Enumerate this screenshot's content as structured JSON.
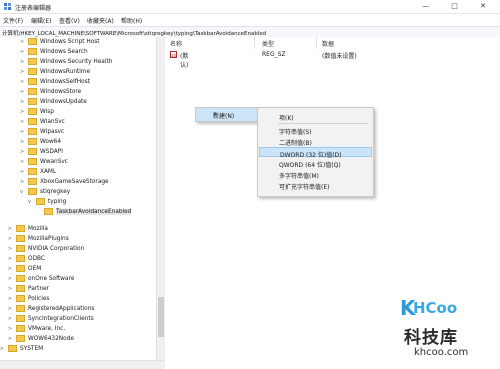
{
  "window": {
    "title": "注册表编辑器",
    "controls": "— □ ✕"
  },
  "menubar": {
    "items": [
      "文件(F)",
      "编辑(E)",
      "查看(V)",
      "收藏夹(A)",
      "帮助(H)"
    ]
  },
  "address": "计算机\\HKEY_LOCAL_MACHINE\\SOFTWARE\\Microsoft\\stiqregkey\\typing\\TaskbarAvoidanceEnabled",
  "tree": {
    "items": [
      "Windows Script Host",
      "Windows Search",
      "Windows Security Health",
      "WindowsRuntime",
      "WindowsSelfHost",
      "WindowsStore",
      "WindowsUpdate",
      "Wisp",
      "WlanSvc",
      "Wlpasvc",
      "Wow64",
      "WSDAPI",
      "WwanSvc",
      "XAML",
      "XboxGameSaveStorage",
      "stiqregkey",
      "typing",
      "TaskbarAvoidanceEnabled",
      "Mozilla",
      "MozillaPlugins",
      "NVIDIA Corporation",
      "ODBC",
      "OEM",
      "onOne Software",
      "Partner",
      "Policies",
      "RegisteredApplications",
      "SyncIntegrationClients",
      "VMware, Inc.",
      "WOW6432Node",
      "SYSTEM"
    ]
  },
  "columns": {
    "name": "名称",
    "type": "类型",
    "data": "数据"
  },
  "values": [
    {
      "name": "(默认)",
      "type": "REG_SZ",
      "data": "(数值未设置)"
    }
  ],
  "context_menu": {
    "new_label": "新建(N)",
    "submenu_arrow": ">",
    "submenu": [
      "项(K)",
      "字符串值(S)",
      "二进制值(B)",
      "DWORD (32 位)值(D)",
      "QWORD (64 位)值(Q)",
      "多字符串值(M)",
      "可扩充字符串值(E)"
    ],
    "highlighted_index": 3
  },
  "watermark": {
    "logo_k": "K",
    "logo_text": "HCoo",
    "name": "科技库",
    "url": "khcoo.com"
  },
  "colors": {
    "folder": "#f2c94c",
    "highlight": "#cce4f7",
    "watermark_blue": "#2f9ad9"
  }
}
